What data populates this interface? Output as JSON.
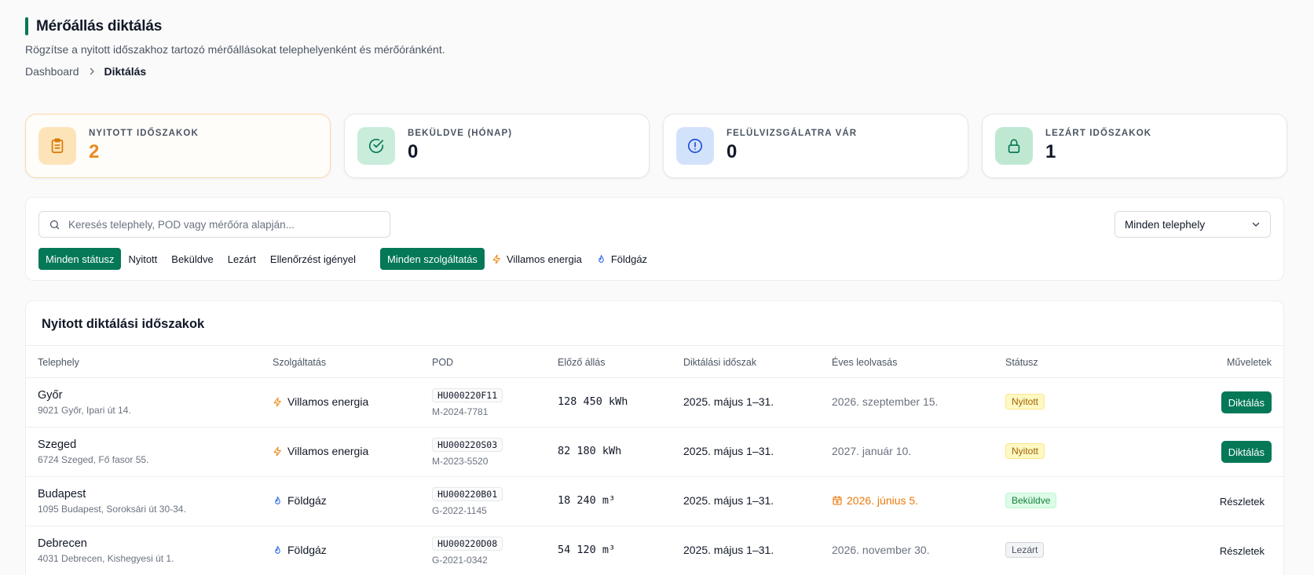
{
  "header": {
    "title": "Mérőállás diktálás",
    "subtitle": "Rögzítse a nyitott időszakhoz tartozó mérőállásokat telephelyenként és mérőóránként.",
    "breadcrumb": {
      "parent": "Dashboard",
      "current": "Diktálás"
    }
  },
  "stats": [
    {
      "label": "NYITOTT IDŐSZAKOK",
      "value": "2",
      "icon": "clipboard-icon",
      "icon_bg": "#fde4b8",
      "icon_color": "#d97706"
    },
    {
      "label": "BEKÜLDVE (HÓNAP)",
      "value": "0",
      "icon": "check-circle-icon",
      "icon_bg": "#c9ecdb",
      "icon_color": "#047857"
    },
    {
      "label": "FELÜLVIZSGÁLATRA VÁR",
      "value": "0",
      "icon": "alert-circle-icon",
      "icon_bg": "#d3e2fb",
      "icon_color": "#1d4ed8"
    },
    {
      "label": "LEZÁRT IDŐSZAKOK",
      "value": "1",
      "icon": "lock-icon",
      "icon_bg": "#bfe8d3",
      "icon_color": "#047857"
    }
  ],
  "filters": {
    "search_placeholder": "Keresés telephely, POD vagy mérőóra alapján...",
    "site_select": "Minden telephely",
    "status_chips": [
      "Minden státusz",
      "Nyitott",
      "Beküldve",
      "Lezárt",
      "Ellenőrzést igényel"
    ],
    "service_chips": [
      "Minden szolgáltatás",
      "Villamos energia",
      "Földgáz"
    ]
  },
  "table": {
    "title": "Nyitott diktálási időszakok",
    "columns": [
      "Telephely",
      "Szolgáltatás",
      "POD",
      "Előző állás",
      "Diktálási időszak",
      "Éves leolvasás",
      "Státusz",
      "Műveletek"
    ],
    "rows": [
      {
        "site": "Győr",
        "address": "9021 Győr, Ipari út 14.",
        "service": "Villamos energia",
        "service_icon": "bolt-icon",
        "pod": "HU000220F11",
        "meter": "M-2024-7781",
        "prev": "128 450 kWh",
        "period": "2025. május 1–31.",
        "annual": "2026. szeptember 15.",
        "status": "Nyitott",
        "action": "Diktálás"
      },
      {
        "site": "Szeged",
        "address": "6724 Szeged, Fő fasor 55.",
        "service": "Villamos energia",
        "service_icon": "bolt-icon",
        "pod": "HU000220S03",
        "meter": "M-2023-5520",
        "prev": "82 180 kWh",
        "period": "2025. május 1–31.",
        "annual": "2027. január 10.",
        "status": "Nyitott",
        "action": "Diktálás"
      },
      {
        "site": "Budapest",
        "address": "1095 Budapest, Soroksári út 30-34.",
        "service": "Földgáz",
        "service_icon": "flame-icon",
        "pod": "HU000220B01",
        "meter": "G-2022-1145",
        "prev": "18 240 m³",
        "period": "2025. május 1–31.",
        "annual": "2026. június 5.",
        "status": "Beküldve",
        "action": "Részletek"
      },
      {
        "site": "Debrecen",
        "address": "4031 Debrecen, Kishegyesi út 1.",
        "service": "Földgáz",
        "service_icon": "flame-icon",
        "pod": "HU000220D08",
        "meter": "G-2021-0342",
        "prev": "54 120 m³",
        "period": "2025. május 1–31.",
        "annual": "2026. november 30.",
        "status": "Lezárt",
        "action": "Részletek"
      }
    ]
  }
}
